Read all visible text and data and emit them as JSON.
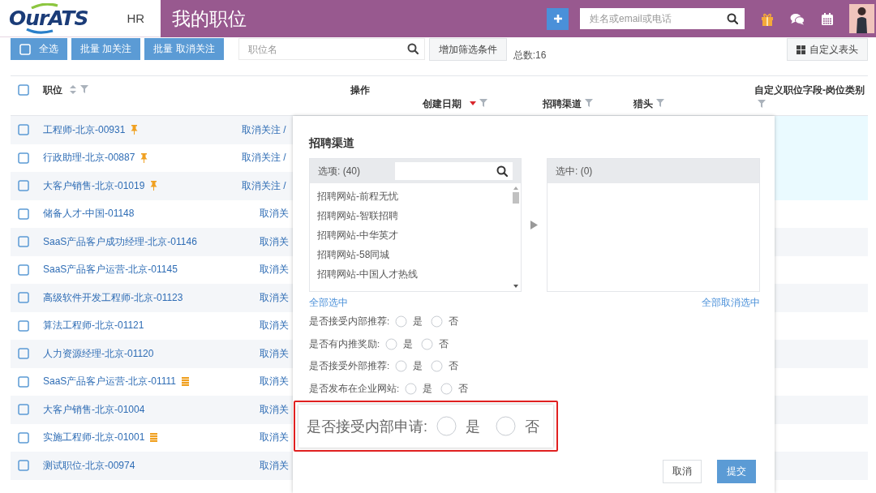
{
  "header": {
    "logo": "OurATS",
    "role": "HR",
    "title": "我的职位",
    "search": {
      "placeholder": "姓名或email或电话"
    }
  },
  "toolbar": {
    "select_all": {
      "label": "全选",
      "checked": false
    },
    "buttons": [
      "批量 加关注",
      "批量 取消关注"
    ],
    "search": {
      "placeholder": "职位名"
    },
    "filter_button": "增加筛选条件",
    "total": "总数:16",
    "columns_button": "自定义表头"
  },
  "table": {
    "header_checked": false,
    "columns": [
      {
        "label": "职位",
        "sortable": true,
        "sorted_desc": false,
        "filter": true
      },
      {
        "label": "操作",
        "sortable": false,
        "sorted_desc": false,
        "filter": false
      },
      {
        "label": "创建日期",
        "sortable": false,
        "sorted_desc": true,
        "filter": true
      },
      {
        "label": "招聘渠道",
        "sortable": false,
        "sorted_desc": false,
        "filter": true
      },
      {
        "label": "猎头",
        "sortable": false,
        "sorted_desc": false,
        "filter": true
      },
      {
        "label": "自定义职位字段-岗位类别",
        "sortable": false,
        "sorted_desc": false,
        "filter": true
      }
    ],
    "rows": [
      {
        "title": "工程师-北京-00931",
        "action": "取消关注 /",
        "checked": false,
        "pinned": true
      },
      {
        "title": "行政助理-北京-00887",
        "action": "取消关注 /",
        "checked": false,
        "pinned": true
      },
      {
        "title": "大客户销售-北京-01019",
        "action": "取消关注 /",
        "checked": false,
        "pinned": true
      },
      {
        "title": "储备人才-中国-01148",
        "action": "取消关",
        "checked": false,
        "pinned": false
      },
      {
        "title": "SaaS产品客户成功经理-北京-01146",
        "action": "取消关",
        "checked": false,
        "pinned": false
      },
      {
        "title": "SaaS产品客户运营-北京-01145",
        "action": "取消关",
        "checked": false,
        "pinned": false
      },
      {
        "title": "高级软件开发工程师-北京-01123",
        "action": "取消关",
        "checked": false,
        "pinned": false
      },
      {
        "title": "算法工程师-北京-01121",
        "action": "取消关",
        "checked": false,
        "pinned": false
      },
      {
        "title": "人力资源经理-北京-01120",
        "action": "取消关",
        "checked": false,
        "pinned": false
      },
      {
        "title": "SaaS产品客户运营-北京-01111",
        "kind": "stacked",
        "action": "取消关",
        "checked": false,
        "pinned": false
      },
      {
        "title": "大客户销售-北京-01004",
        "action": "取消关",
        "checked": false,
        "pinned": false
      },
      {
        "title": "实施工程师-北京-01001",
        "kind": "stacked",
        "action": "取消关",
        "checked": false,
        "pinned": false
      },
      {
        "title": "测试职位-北京-00974",
        "action": "取消关",
        "checked": false,
        "pinned": false
      }
    ]
  },
  "modal": {
    "title": "招聘渠道",
    "options": {
      "header": "选项: (40)",
      "items": [
        "招聘网站-前程无忧",
        "招聘网站-智联招聘",
        "招聘网站-中华英才",
        "招聘网站-58同城",
        "招聘网站-中国人才热线"
      ]
    },
    "chosen": {
      "header": "选中: (0)"
    },
    "select_all": "全部选中",
    "deselect_all": "全部取消选中",
    "questions": [
      {
        "label": "是否接受内部推荐:",
        "options": [
          {
            "label": "是",
            "selected": false
          },
          {
            "label": "否",
            "selected": false
          }
        ]
      },
      {
        "label": "是否有内推奖励:",
        "options": [
          {
            "label": "是",
            "selected": false
          },
          {
            "label": "否",
            "selected": false
          }
        ]
      },
      {
        "label": "是否接受外部推荐:",
        "options": [
          {
            "label": "是",
            "selected": false
          },
          {
            "label": "否",
            "selected": false
          }
        ]
      },
      {
        "label": "是否发布在企业网站:",
        "options": [
          {
            "label": "是",
            "selected": false
          },
          {
            "label": "否",
            "selected": false
          }
        ]
      }
    ],
    "callout": {
      "label": "是否接受内部申请:",
      "options": [
        {
          "label": "是",
          "selected": false
        },
        {
          "label": "否",
          "selected": false
        }
      ]
    },
    "buttons": [
      {
        "label": "取消",
        "kind": "secondary"
      },
      {
        "label": "提交",
        "kind": "primary"
      }
    ]
  }
}
